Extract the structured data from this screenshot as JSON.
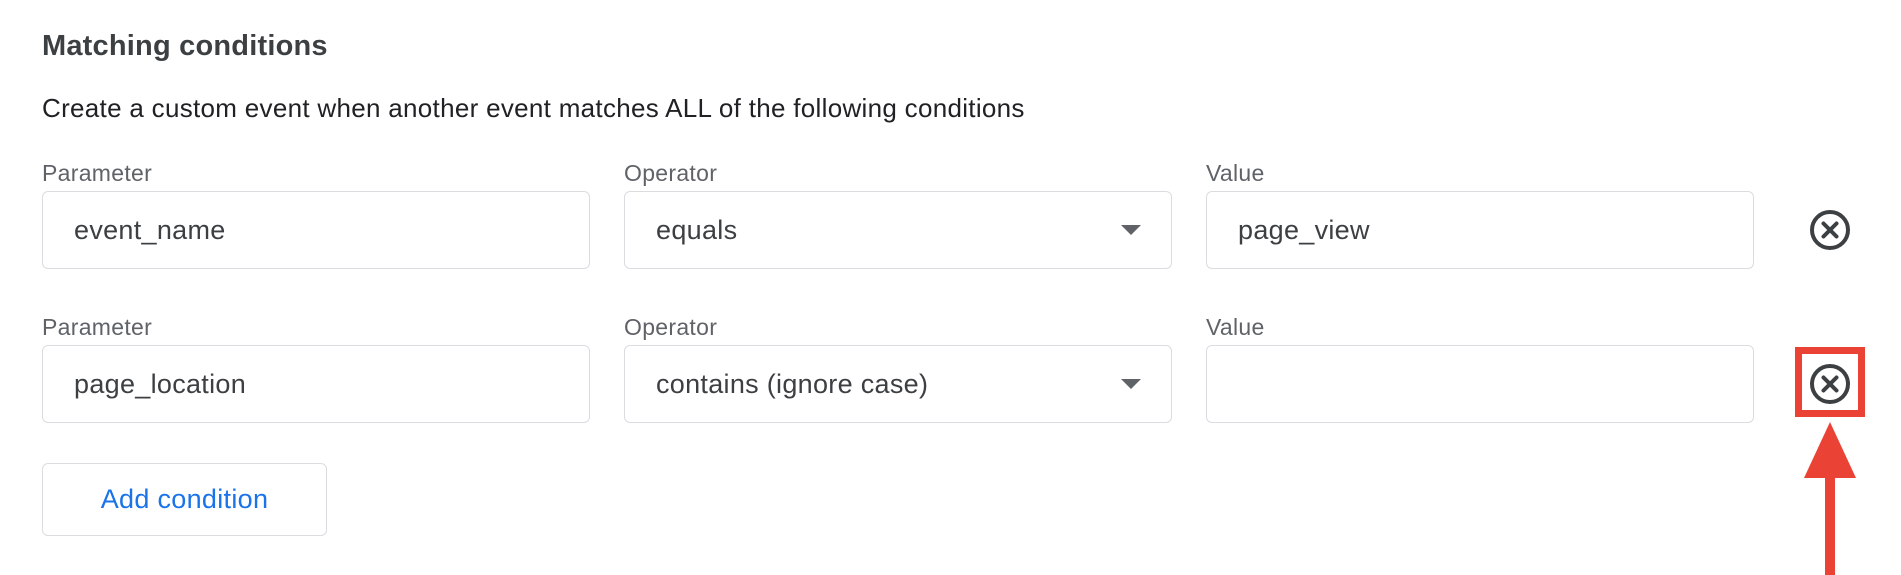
{
  "section": {
    "title": "Matching conditions",
    "description": "Create a custom event when another event matches ALL of the following conditions"
  },
  "conditions": [
    {
      "parameter_label": "Parameter",
      "parameter_value": "event_name",
      "operator_label": "Operator",
      "operator_value": "equals",
      "value_label": "Value",
      "value_value": "page_view",
      "remove_icon": "close-circle-icon"
    },
    {
      "parameter_label": "Parameter",
      "parameter_value": "page_location",
      "operator_label": "Operator",
      "operator_value": "contains (ignore case)",
      "value_label": "Value",
      "value_value": "",
      "remove_icon": "close-circle-icon"
    }
  ],
  "add_condition_label": "Add condition",
  "colors": {
    "accent_blue": "#1a73e8",
    "annotation_red": "#ea4335",
    "border_gray": "#dadce0",
    "label_gray": "#5f6368"
  }
}
